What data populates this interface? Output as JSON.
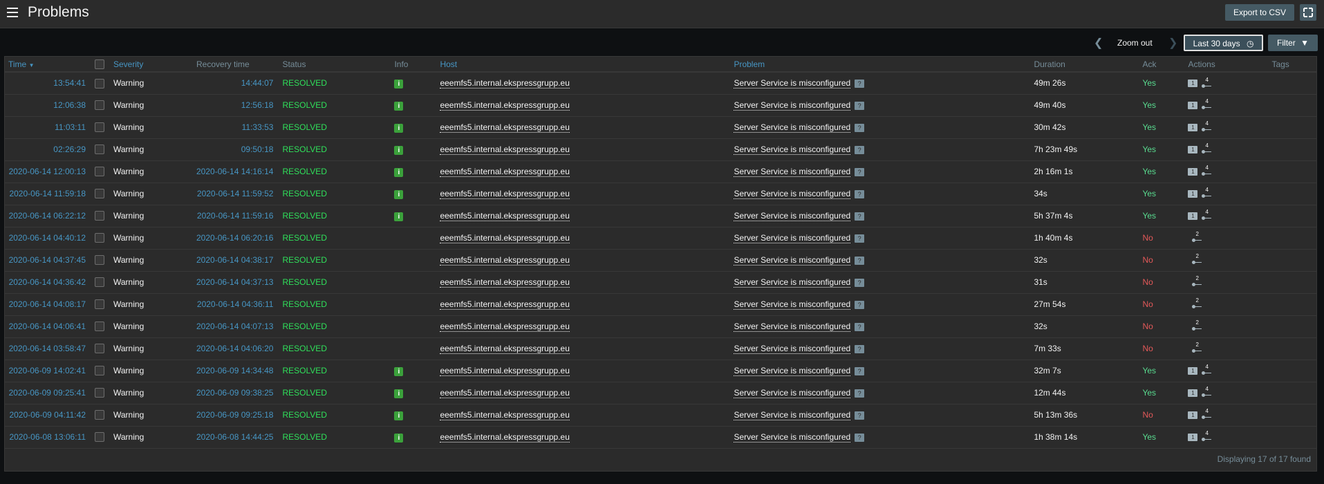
{
  "header": {
    "title": "Problems",
    "export_label": "Export to CSV"
  },
  "timebar": {
    "zoom_out": "Zoom out",
    "range_label": "Last 30 days",
    "filter_label": "Filter"
  },
  "columns": {
    "time": "Time",
    "severity": "Severity",
    "recovery": "Recovery time",
    "status": "Status",
    "info": "Info",
    "host": "Host",
    "problem": "Problem",
    "duration": "Duration",
    "ack": "Ack",
    "actions": "Actions",
    "tags": "Tags"
  },
  "rows": [
    {
      "time": "13:54:41",
      "severity": "Warning",
      "recovery": "14:44:07",
      "status": "RESOLVED",
      "info": true,
      "host": "eeemfs5.internal.ekspressgrupp.eu",
      "problem": "Server Service is misconfigured",
      "duration": "49m 26s",
      "ack": "Yes",
      "msg": "1",
      "ops": "4"
    },
    {
      "time": "12:06:38",
      "severity": "Warning",
      "recovery": "12:56:18",
      "status": "RESOLVED",
      "info": true,
      "host": "eeemfs5.internal.ekspressgrupp.eu",
      "problem": "Server Service is misconfigured",
      "duration": "49m 40s",
      "ack": "Yes",
      "msg": "1",
      "ops": "4"
    },
    {
      "time": "11:03:11",
      "severity": "Warning",
      "recovery": "11:33:53",
      "status": "RESOLVED",
      "info": true,
      "host": "eeemfs5.internal.ekspressgrupp.eu",
      "problem": "Server Service is misconfigured",
      "duration": "30m 42s",
      "ack": "Yes",
      "msg": "1",
      "ops": "4"
    },
    {
      "time": "02:26:29",
      "severity": "Warning",
      "recovery": "09:50:18",
      "status": "RESOLVED",
      "info": true,
      "host": "eeemfs5.internal.ekspressgrupp.eu",
      "problem": "Server Service is misconfigured",
      "duration": "7h 23m 49s",
      "ack": "Yes",
      "msg": "1",
      "ops": "4"
    },
    {
      "time": "2020-06-14 12:00:13",
      "severity": "Warning",
      "recovery": "2020-06-14 14:16:14",
      "status": "RESOLVED",
      "info": true,
      "host": "eeemfs5.internal.ekspressgrupp.eu",
      "problem": "Server Service is misconfigured",
      "duration": "2h 16m 1s",
      "ack": "Yes",
      "msg": "1",
      "ops": "4"
    },
    {
      "time": "2020-06-14 11:59:18",
      "severity": "Warning",
      "recovery": "2020-06-14 11:59:52",
      "status": "RESOLVED",
      "info": true,
      "host": "eeemfs5.internal.ekspressgrupp.eu",
      "problem": "Server Service is misconfigured",
      "duration": "34s",
      "ack": "Yes",
      "msg": "1",
      "ops": "4"
    },
    {
      "time": "2020-06-14 06:22:12",
      "severity": "Warning",
      "recovery": "2020-06-14 11:59:16",
      "status": "RESOLVED",
      "info": true,
      "host": "eeemfs5.internal.ekspressgrupp.eu",
      "problem": "Server Service is misconfigured",
      "duration": "5h 37m 4s",
      "ack": "Yes",
      "msg": "1",
      "ops": "4"
    },
    {
      "time": "2020-06-14 04:40:12",
      "severity": "Warning",
      "recovery": "2020-06-14 06:20:16",
      "status": "RESOLVED",
      "info": false,
      "host": "eeemfs5.internal.ekspressgrupp.eu",
      "problem": "Server Service is misconfigured",
      "duration": "1h 40m 4s",
      "ack": "No",
      "msg": "",
      "ops": "2"
    },
    {
      "time": "2020-06-14 04:37:45",
      "severity": "Warning",
      "recovery": "2020-06-14 04:38:17",
      "status": "RESOLVED",
      "info": false,
      "host": "eeemfs5.internal.ekspressgrupp.eu",
      "problem": "Server Service is misconfigured",
      "duration": "32s",
      "ack": "No",
      "msg": "",
      "ops": "2"
    },
    {
      "time": "2020-06-14 04:36:42",
      "severity": "Warning",
      "recovery": "2020-06-14 04:37:13",
      "status": "RESOLVED",
      "info": false,
      "host": "eeemfs5.internal.ekspressgrupp.eu",
      "problem": "Server Service is misconfigured",
      "duration": "31s",
      "ack": "No",
      "msg": "",
      "ops": "2"
    },
    {
      "time": "2020-06-14 04:08:17",
      "severity": "Warning",
      "recovery": "2020-06-14 04:36:11",
      "status": "RESOLVED",
      "info": false,
      "host": "eeemfs5.internal.ekspressgrupp.eu",
      "problem": "Server Service is misconfigured",
      "duration": "27m 54s",
      "ack": "No",
      "msg": "",
      "ops": "2"
    },
    {
      "time": "2020-06-14 04:06:41",
      "severity": "Warning",
      "recovery": "2020-06-14 04:07:13",
      "status": "RESOLVED",
      "info": false,
      "host": "eeemfs5.internal.ekspressgrupp.eu",
      "problem": "Server Service is misconfigured",
      "duration": "32s",
      "ack": "No",
      "msg": "",
      "ops": "2"
    },
    {
      "time": "2020-06-14 03:58:47",
      "severity": "Warning",
      "recovery": "2020-06-14 04:06:20",
      "status": "RESOLVED",
      "info": false,
      "host": "eeemfs5.internal.ekspressgrupp.eu",
      "problem": "Server Service is misconfigured",
      "duration": "7m 33s",
      "ack": "No",
      "msg": "",
      "ops": "2"
    },
    {
      "time": "2020-06-09 14:02:41",
      "severity": "Warning",
      "recovery": "2020-06-09 14:34:48",
      "status": "RESOLVED",
      "info": true,
      "host": "eeemfs5.internal.ekspressgrupp.eu",
      "problem": "Server Service is misconfigured",
      "duration": "32m 7s",
      "ack": "Yes",
      "msg": "1",
      "ops": "4"
    },
    {
      "time": "2020-06-09 09:25:41",
      "severity": "Warning",
      "recovery": "2020-06-09 09:38:25",
      "status": "RESOLVED",
      "info": true,
      "host": "eeemfs5.internal.ekspressgrupp.eu",
      "problem": "Server Service is misconfigured",
      "duration": "12m 44s",
      "ack": "Yes",
      "msg": "1",
      "ops": "4"
    },
    {
      "time": "2020-06-09 04:11:42",
      "severity": "Warning",
      "recovery": "2020-06-09 09:25:18",
      "status": "RESOLVED",
      "info": true,
      "host": "eeemfs5.internal.ekspressgrupp.eu",
      "problem": "Server Service is misconfigured",
      "duration": "5h 13m 36s",
      "ack": "No",
      "msg": "1",
      "ops": "4"
    },
    {
      "time": "2020-06-08 13:06:11",
      "severity": "Warning",
      "recovery": "2020-06-08 14:44:25",
      "status": "RESOLVED",
      "info": true,
      "host": "eeemfs5.internal.ekspressgrupp.eu",
      "problem": "Server Service is misconfigured",
      "duration": "1h 38m 14s",
      "ack": "Yes",
      "msg": "1",
      "ops": "4"
    }
  ],
  "footer": "Displaying 17 of 17 found",
  "colors": {
    "link": "#4796c4",
    "resolved": "#2fe05a",
    "ack_yes": "#59db8f",
    "ack_no": "#e45959"
  }
}
